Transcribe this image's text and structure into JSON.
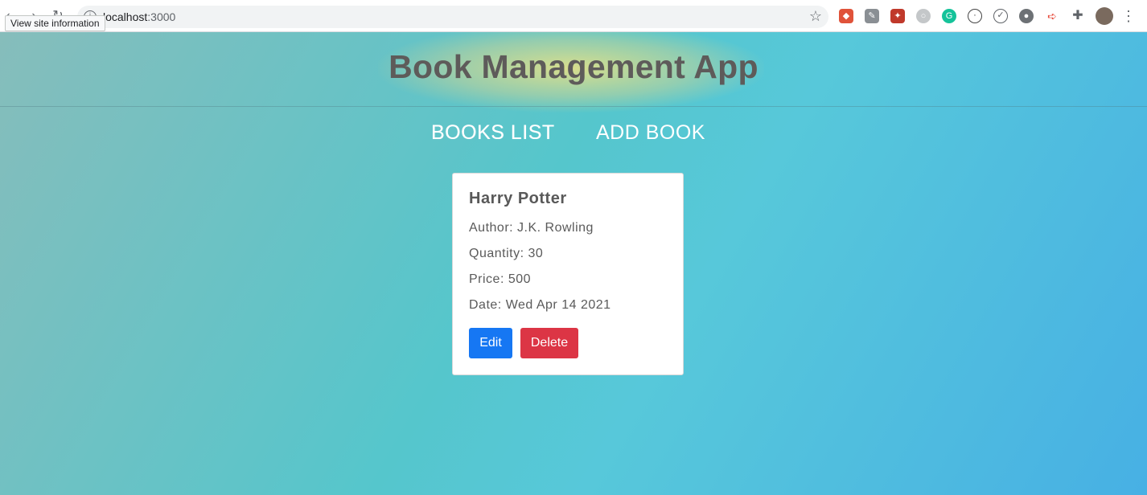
{
  "browser": {
    "url_host": "localhost",
    "url_port": ":3000",
    "site_info_tooltip": "View site information",
    "extensions": [
      {
        "name": "ext-icon-1",
        "color": "#e0533a"
      },
      {
        "name": "ext-icon-2",
        "color": "#8a8f94"
      },
      {
        "name": "ext-icon-3",
        "color": "#c0392b"
      },
      {
        "name": "ext-icon-4",
        "color": "#b0b4b8"
      },
      {
        "name": "grammarly",
        "color": "#15c39a",
        "glyph": "G"
      },
      {
        "name": "ext-icon-6",
        "color": "#4a4a4a"
      },
      {
        "name": "ext-icon-7",
        "color": "#5f6368"
      },
      {
        "name": "ext-icon-8",
        "color": "#5f6368"
      },
      {
        "name": "ext-icon-9",
        "color": "#e74c3c"
      },
      {
        "name": "puzzle",
        "color": "#5f6368"
      }
    ]
  },
  "app": {
    "title": "Book Management App",
    "nav": {
      "books_list": "BOOKS LIST",
      "add_book": "ADD BOOK"
    }
  },
  "book": {
    "title": "Harry Potter",
    "author": "Author: J.K. Rowling",
    "quantity": "Quantity: 30",
    "price": "Price: 500",
    "date": "Date: Wed Apr 14 2021",
    "edit_label": "Edit",
    "delete_label": "Delete"
  }
}
